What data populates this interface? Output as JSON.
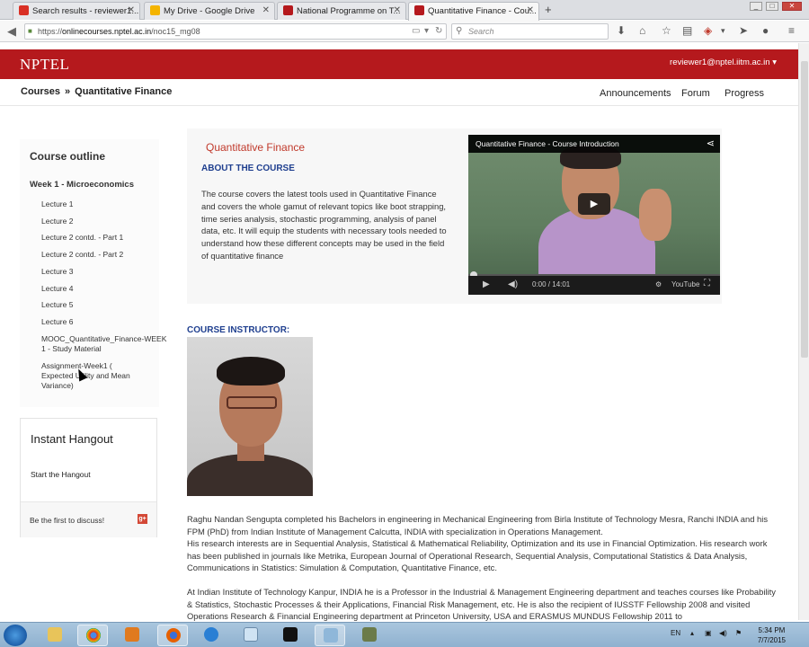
{
  "browser": {
    "tabs": [
      {
        "label": "Search results - reviewer1...",
        "color": "#d93025"
      },
      {
        "label": "My Drive - Google Drive",
        "color": "#f4b400"
      },
      {
        "label": "National Programme on T...",
        "color": "#b5191d"
      },
      {
        "label": "Quantitative Finance - Cou...",
        "color": "#b5191d",
        "active": true
      }
    ],
    "new_tab": "+",
    "url_prefix": "https://",
    "url_domain": "onlinecourses.nptel.ac.in",
    "url_path": "/noc15_mg08",
    "search_placeholder": "Search"
  },
  "site": {
    "logo": "NPTEL",
    "user": "reviewer1@nptel.iitm.ac.in ▾",
    "brand_color": "#b5191d"
  },
  "breadcrumb": {
    "root": "Courses",
    "sep": "»",
    "current": "Quantitative Finance"
  },
  "topnav": [
    "Announcements",
    "Forum",
    "Progress"
  ],
  "sidebar": {
    "title": "Course outline",
    "week": "Week 1 - Microeconomics",
    "items": [
      "Lecture 1",
      "Lecture 2",
      "Lecture 2 contd. - Part 1",
      "Lecture 2 contd. - Part 2",
      "Lecture 3",
      "Lecture 4",
      "Lecture 5",
      "Lecture 6",
      "MOOC_Quantitative_Finance-WEEK 1 - Study Material",
      "Assignment-Week1 ( Expected Utility and Mean Variance)"
    ]
  },
  "hangout": {
    "title": "Instant Hangout",
    "start": "Start the Hangout",
    "discuss": "Be the first to discuss!",
    "gplus": "g+"
  },
  "course": {
    "title": "Quantitative Finance",
    "about_heading": "ABOUT THE COURSE",
    "about_text": "The course covers the latest tools used in Quantitative Finance and covers the whole gamut of relevant topics like boot strapping, time series analysis, stochastic programming, analysis of panel data, etc. It will equip the students with necessary tools needed to understand how these different concepts may be used in the field of quantitative finance"
  },
  "video": {
    "title": "Quantitative Finance - Course Introduction",
    "time": "0:00 / 14:01",
    "youtube": "YouTube"
  },
  "instructor": {
    "heading": "COURSE INSTRUCTOR:",
    "bio1": "Raghu Nandan Sengupta completed his Bachelors in engineering in Mechanical Engineering from Birla Institute of Technology Mesra, Ranchi INDIA and his FPM (PhD) from Indian Institute of Management Calcutta, INDIA with specialization in Operations Management.",
    "bio2": "His research interests are in Sequential Analysis, Statistical & Mathematical Reliability, Optimization and its use in Financial Optimization. His research work has been published in journals like Metrika, European Journal of Operational Research, Sequential Analysis, Computational Statistics & Data Analysis, Communications in Statistics: Simulation & Computation, Quantitative Finance, etc.",
    "bio3": "At Indian Institute of Technology Kanpur, INDIA he is a Professor in the Industrial & Management Engineering department and teaches courses like Probability & Statistics, Stochastic Processes & their Applications, Financial Risk Management, etc. He is also the recipient of IUSSTF Fellowship 2008 and visited Operations Research & Financial Engineering department at Princeton University, USA and ERASMUS MUNDUS Fellowship 2011 to"
  },
  "taskbar": {
    "lang": "EN",
    "time": "5:34 PM",
    "date": "7/7/2015"
  }
}
